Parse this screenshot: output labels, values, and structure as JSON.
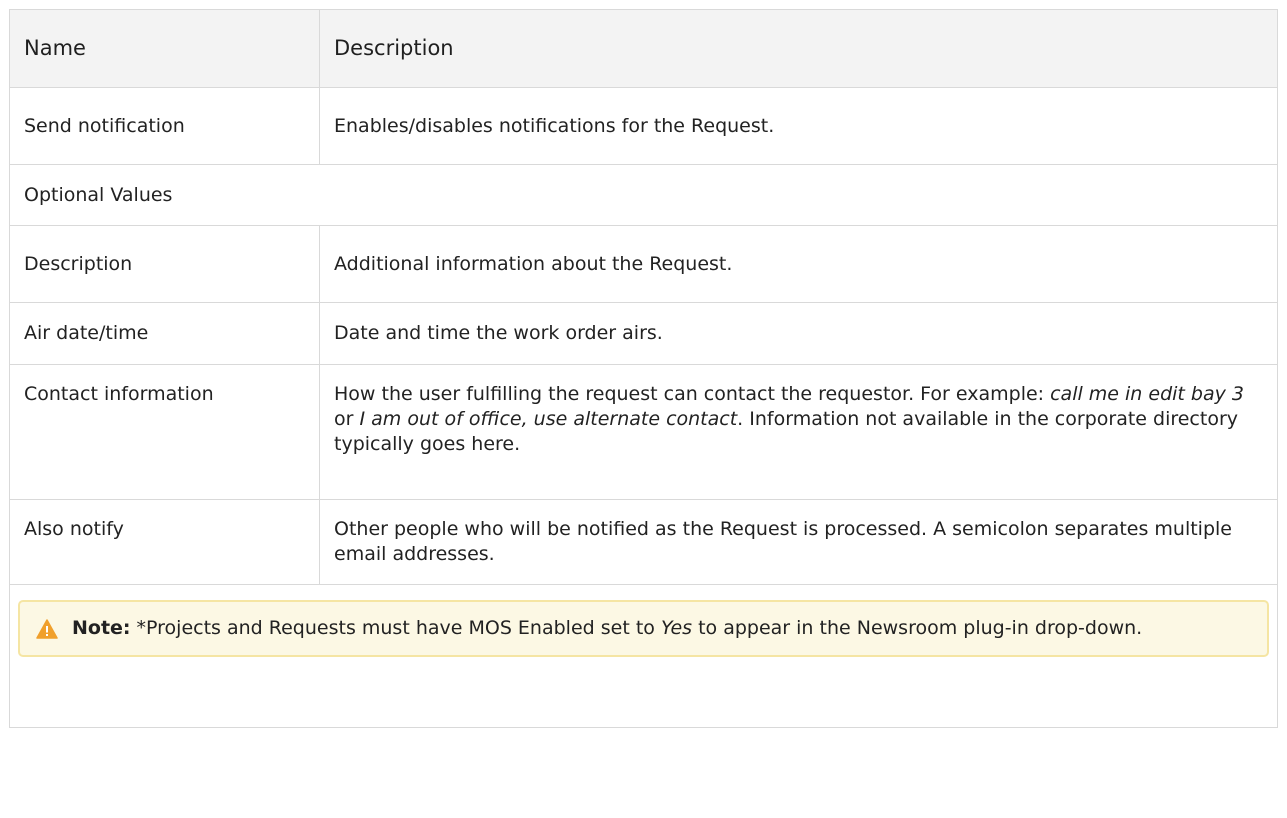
{
  "table": {
    "headers": {
      "name": "Name",
      "description": "Description"
    },
    "send_notification": {
      "name": "Send notification",
      "description": "Enables/disables notifications for the Request."
    },
    "section": "Optional Values",
    "description_row": {
      "name": "Description",
      "description": "Additional information about the Request."
    },
    "air_row": {
      "name": "Air date/time",
      "description": "Date and time the work order airs."
    },
    "contact_row": {
      "name": "Contact information",
      "text_1": "How the user fulfilling the request can contact the requestor. For example: ",
      "em_1": "call me in edit bay 3",
      "text_2": " or ",
      "em_2": "I am out of office, use alternate contact",
      "text_3": ". Information not available in the corporate directory typically goes here."
    },
    "notify_row": {
      "name": "Also notify",
      "description": "Other people who will be notified as the Request is processed. A semicolon separates multiple email addresses."
    }
  },
  "note": {
    "icon": "warning-icon",
    "label": "Note:",
    "text_1": "*Projects and Requests must have MOS Enabled set to ",
    "em": "Yes",
    "text_2": " to appear in the Newsroom plug-in drop-down."
  },
  "colors": {
    "header_bg": "#f3f3f3",
    "border": "#d9d9d9",
    "note_bg": "#fcf8e4",
    "note_border": "#f5e5a3",
    "warning": "#f0a02c"
  }
}
